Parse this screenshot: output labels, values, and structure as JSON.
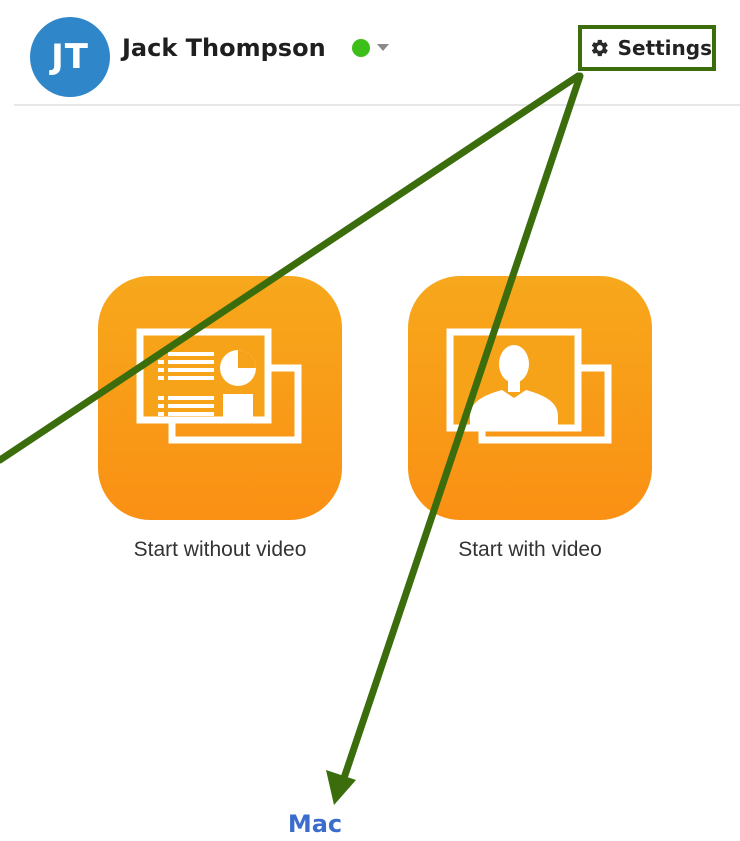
{
  "header": {
    "avatar_initials": "JT",
    "user_name": "Jack Thompson",
    "status_color": "#3dbf1a",
    "settings_label": "Settings",
    "settings_icon": "gear-icon"
  },
  "tiles": [
    {
      "label": "Start without video",
      "icon": "screen-share-presentation-icon"
    },
    {
      "label": "Start with video",
      "icon": "video-person-icon"
    }
  ],
  "annotation": {
    "platform_label": "Mac",
    "highlight_color": "#3b6d0c"
  }
}
